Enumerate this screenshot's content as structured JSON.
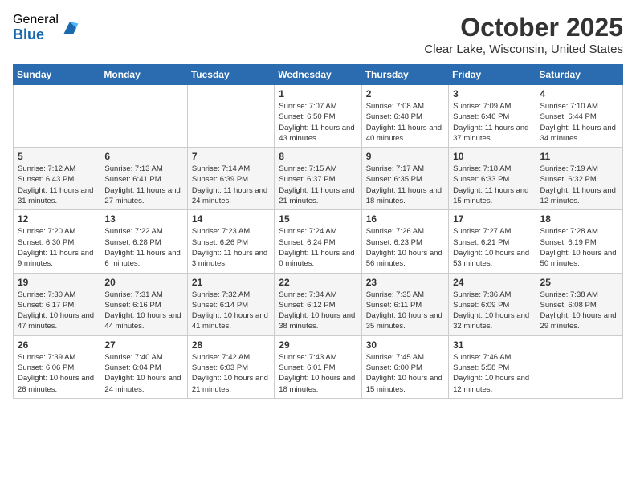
{
  "header": {
    "logo_general": "General",
    "logo_blue": "Blue",
    "month_title": "October 2025",
    "location": "Clear Lake, Wisconsin, United States"
  },
  "days_of_week": [
    "Sunday",
    "Monday",
    "Tuesday",
    "Wednesday",
    "Thursday",
    "Friday",
    "Saturday"
  ],
  "weeks": [
    [
      {
        "day": "",
        "info": ""
      },
      {
        "day": "",
        "info": ""
      },
      {
        "day": "",
        "info": ""
      },
      {
        "day": "1",
        "info": "Sunrise: 7:07 AM\nSunset: 6:50 PM\nDaylight: 11 hours\nand 43 minutes."
      },
      {
        "day": "2",
        "info": "Sunrise: 7:08 AM\nSunset: 6:48 PM\nDaylight: 11 hours\nand 40 minutes."
      },
      {
        "day": "3",
        "info": "Sunrise: 7:09 AM\nSunset: 6:46 PM\nDaylight: 11 hours\nand 37 minutes."
      },
      {
        "day": "4",
        "info": "Sunrise: 7:10 AM\nSunset: 6:44 PM\nDaylight: 11 hours\nand 34 minutes."
      }
    ],
    [
      {
        "day": "5",
        "info": "Sunrise: 7:12 AM\nSunset: 6:43 PM\nDaylight: 11 hours\nand 31 minutes."
      },
      {
        "day": "6",
        "info": "Sunrise: 7:13 AM\nSunset: 6:41 PM\nDaylight: 11 hours\nand 27 minutes."
      },
      {
        "day": "7",
        "info": "Sunrise: 7:14 AM\nSunset: 6:39 PM\nDaylight: 11 hours\nand 24 minutes."
      },
      {
        "day": "8",
        "info": "Sunrise: 7:15 AM\nSunset: 6:37 PM\nDaylight: 11 hours\nand 21 minutes."
      },
      {
        "day": "9",
        "info": "Sunrise: 7:17 AM\nSunset: 6:35 PM\nDaylight: 11 hours\nand 18 minutes."
      },
      {
        "day": "10",
        "info": "Sunrise: 7:18 AM\nSunset: 6:33 PM\nDaylight: 11 hours\nand 15 minutes."
      },
      {
        "day": "11",
        "info": "Sunrise: 7:19 AM\nSunset: 6:32 PM\nDaylight: 11 hours\nand 12 minutes."
      }
    ],
    [
      {
        "day": "12",
        "info": "Sunrise: 7:20 AM\nSunset: 6:30 PM\nDaylight: 11 hours\nand 9 minutes."
      },
      {
        "day": "13",
        "info": "Sunrise: 7:22 AM\nSunset: 6:28 PM\nDaylight: 11 hours\nand 6 minutes."
      },
      {
        "day": "14",
        "info": "Sunrise: 7:23 AM\nSunset: 6:26 PM\nDaylight: 11 hours\nand 3 minutes."
      },
      {
        "day": "15",
        "info": "Sunrise: 7:24 AM\nSunset: 6:24 PM\nDaylight: 11 hours\nand 0 minutes."
      },
      {
        "day": "16",
        "info": "Sunrise: 7:26 AM\nSunset: 6:23 PM\nDaylight: 10 hours\nand 56 minutes."
      },
      {
        "day": "17",
        "info": "Sunrise: 7:27 AM\nSunset: 6:21 PM\nDaylight: 10 hours\nand 53 minutes."
      },
      {
        "day": "18",
        "info": "Sunrise: 7:28 AM\nSunset: 6:19 PM\nDaylight: 10 hours\nand 50 minutes."
      }
    ],
    [
      {
        "day": "19",
        "info": "Sunrise: 7:30 AM\nSunset: 6:17 PM\nDaylight: 10 hours\nand 47 minutes."
      },
      {
        "day": "20",
        "info": "Sunrise: 7:31 AM\nSunset: 6:16 PM\nDaylight: 10 hours\nand 44 minutes."
      },
      {
        "day": "21",
        "info": "Sunrise: 7:32 AM\nSunset: 6:14 PM\nDaylight: 10 hours\nand 41 minutes."
      },
      {
        "day": "22",
        "info": "Sunrise: 7:34 AM\nSunset: 6:12 PM\nDaylight: 10 hours\nand 38 minutes."
      },
      {
        "day": "23",
        "info": "Sunrise: 7:35 AM\nSunset: 6:11 PM\nDaylight: 10 hours\nand 35 minutes."
      },
      {
        "day": "24",
        "info": "Sunrise: 7:36 AM\nSunset: 6:09 PM\nDaylight: 10 hours\nand 32 minutes."
      },
      {
        "day": "25",
        "info": "Sunrise: 7:38 AM\nSunset: 6:08 PM\nDaylight: 10 hours\nand 29 minutes."
      }
    ],
    [
      {
        "day": "26",
        "info": "Sunrise: 7:39 AM\nSunset: 6:06 PM\nDaylight: 10 hours\nand 26 minutes."
      },
      {
        "day": "27",
        "info": "Sunrise: 7:40 AM\nSunset: 6:04 PM\nDaylight: 10 hours\nand 24 minutes."
      },
      {
        "day": "28",
        "info": "Sunrise: 7:42 AM\nSunset: 6:03 PM\nDaylight: 10 hours\nand 21 minutes."
      },
      {
        "day": "29",
        "info": "Sunrise: 7:43 AM\nSunset: 6:01 PM\nDaylight: 10 hours\nand 18 minutes."
      },
      {
        "day": "30",
        "info": "Sunrise: 7:45 AM\nSunset: 6:00 PM\nDaylight: 10 hours\nand 15 minutes."
      },
      {
        "day": "31",
        "info": "Sunrise: 7:46 AM\nSunset: 5:58 PM\nDaylight: 10 hours\nand 12 minutes."
      },
      {
        "day": "",
        "info": ""
      }
    ]
  ]
}
